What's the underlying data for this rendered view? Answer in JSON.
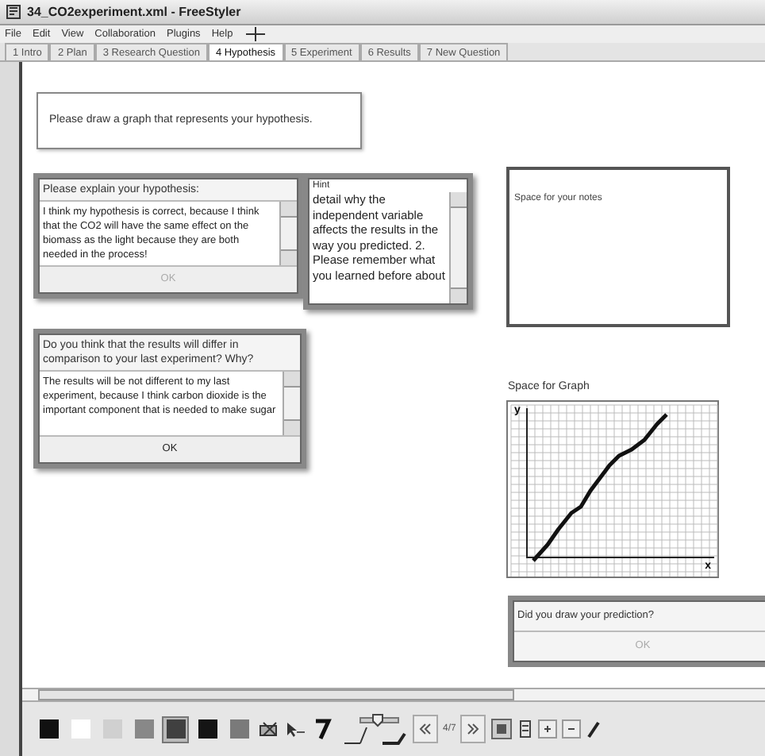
{
  "window": {
    "title": "34_CO2experiment.xml - FreeStyler"
  },
  "menu": [
    "File",
    "Edit",
    "View",
    "Collaboration",
    "Plugins",
    "Help"
  ],
  "tabs": [
    {
      "label": "1 Intro",
      "selected": false
    },
    {
      "label": "2 Plan",
      "selected": false
    },
    {
      "label": "3 Research Question",
      "selected": false
    },
    {
      "label": "4 Hypothesis",
      "selected": true
    },
    {
      "label": "5 Experiment",
      "selected": false
    },
    {
      "label": "6 Results",
      "selected": false
    },
    {
      "label": "7 New Question",
      "selected": false
    }
  ],
  "prompt": "Please draw a graph that represents your hypothesis.",
  "question_panels": [
    {
      "question": "Please explain your hypothesis:",
      "answer": "I think my hypothesis is correct, because I think that the CO2 will have the same effect on the biomass as the light because they are both needed in the process!",
      "button": "OK",
      "disabled": true
    },
    {
      "question": "Do you think that the results will differ in comparison to your last experiment? Why?",
      "answer": "The results will be not different to my last experiment, because I think carbon dioxide is the important component that is needed to make sugar",
      "button": "OK",
      "disabled": false
    }
  ],
  "hint": {
    "title": "Hint",
    "text": "detail why the independent variable affects the results in the way you predicted. 2. Please remember what you learned before about"
  },
  "notes": {
    "label": "Space for your notes"
  },
  "graph": {
    "title": "Space for Graph",
    "y_label": "y",
    "x_label": "x"
  },
  "prediction": {
    "question": "Did you draw your prediction?",
    "button": "OK",
    "disabled": true
  },
  "toolbar": {
    "swatches": [
      {
        "color": "#111111",
        "selected": false
      },
      {
        "color": "#ffffff",
        "selected": false
      },
      {
        "color": "#d0d0d0",
        "selected": false
      },
      {
        "color": "#888888",
        "selected": false
      },
      {
        "color": "#404040",
        "selected": true
      },
      {
        "color": "#151515",
        "selected": false
      },
      {
        "color": "#7a7a7a",
        "selected": false
      }
    ],
    "page": "4/7"
  }
}
